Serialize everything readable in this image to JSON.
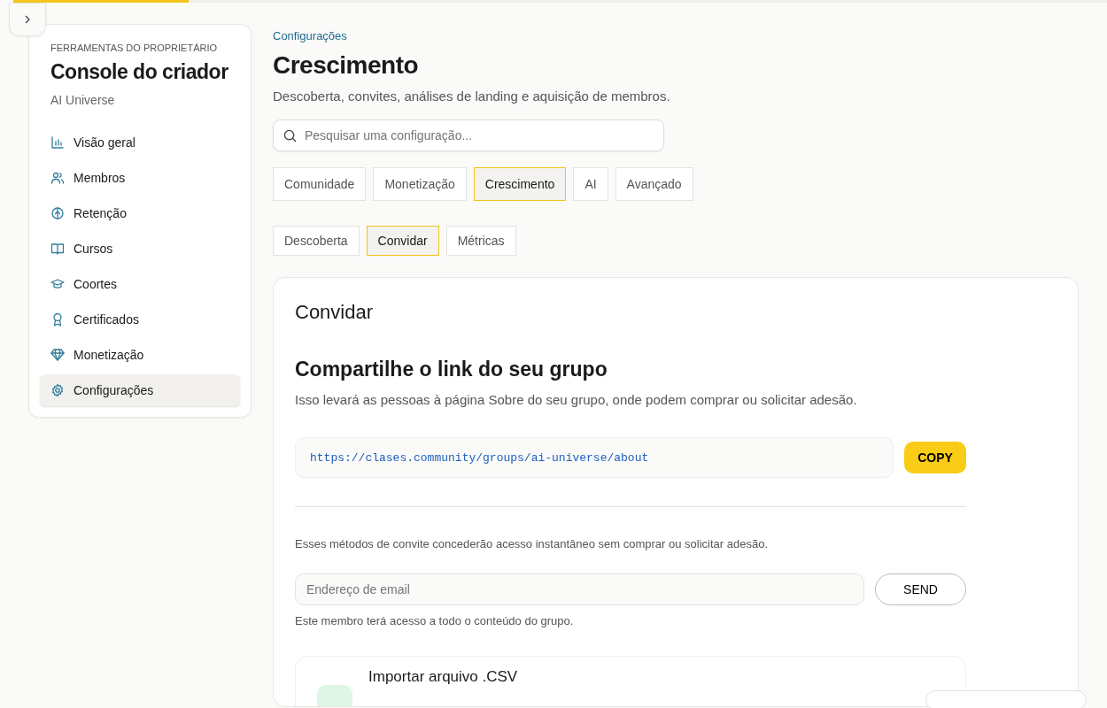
{
  "top_progress": {
    "level": 0.16
  },
  "sidebar": {
    "eyebrow": "FERRAMENTAS DO PROPRIETÁRIO",
    "title": "Console do criador",
    "subtitle": "AI Universe",
    "items": [
      {
        "label": "Visão geral",
        "selected": false
      },
      {
        "label": "Membros",
        "selected": false
      },
      {
        "label": "Retenção",
        "selected": false
      },
      {
        "label": "Cursos",
        "selected": false
      },
      {
        "label": "Coortes",
        "selected": false
      },
      {
        "label": "Certificados",
        "selected": false
      },
      {
        "label": "Monetização",
        "selected": false
      },
      {
        "label": "Configurações",
        "selected": true
      }
    ]
  },
  "breadcrumb": "Configurações",
  "title": "Crescimento",
  "description": "Descoberta, convites, análises de landing e aquisição de membros.",
  "search": {
    "placeholder": "Pesquisar uma configuração..."
  },
  "tabs": [
    {
      "label": "Comunidade",
      "selected": false
    },
    {
      "label": "Monetização",
      "selected": false
    },
    {
      "label": "Crescimento",
      "selected": true
    },
    {
      "label": "AI",
      "selected": false
    },
    {
      "label": "Avançado",
      "selected": false
    }
  ],
  "subtabs": [
    {
      "label": "Descoberta",
      "selected": false
    },
    {
      "label": "Convidar",
      "selected": true
    },
    {
      "label": "Métricas",
      "selected": false
    }
  ],
  "card": {
    "title": "Convidar",
    "share_heading": "Compartilhe o link do seu grupo",
    "share_text": "Isso levará as pessoas à página Sobre do seu grupo, onde podem comprar ou solicitar adesão.",
    "link": "https://clases.community/groups/ai-universe/about",
    "copy_button": "COPY",
    "invite_note": "Esses métodos de convite concederão acesso instantâneo sem comprar ou solicitar adesão.",
    "email": {
      "placeholder": "Endereço de email"
    },
    "send_button": "SEND",
    "email_hint": "Este membro terá acesso a todo o conteúdo do grupo.",
    "import_title": "Importar arquivo .CSV"
  }
}
